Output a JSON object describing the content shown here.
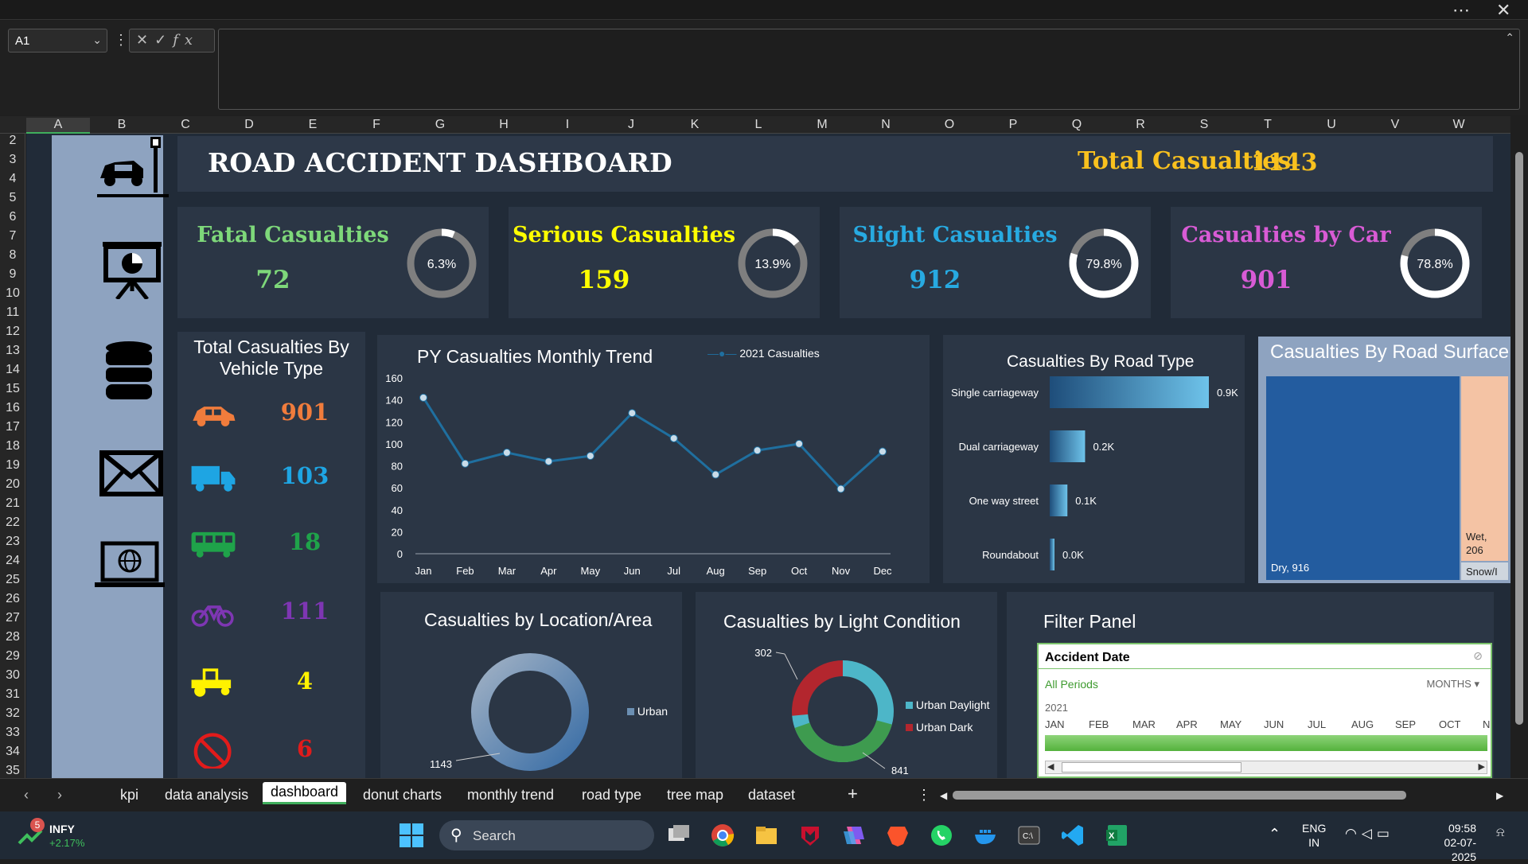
{
  "cell_ref": "A1",
  "columns": [
    "A",
    "B",
    "C",
    "D",
    "E",
    "F",
    "G",
    "H",
    "I",
    "J",
    "K",
    "L",
    "M",
    "N",
    "O",
    "P",
    "Q",
    "R",
    "S",
    "T",
    "U",
    "V",
    "W"
  ],
  "rows": [
    "2",
    "3",
    "4",
    "5",
    "6",
    "7",
    "8",
    "9",
    "10",
    "11",
    "12",
    "13",
    "14",
    "15",
    "16",
    "17",
    "18",
    "19",
    "20",
    "21",
    "22",
    "23",
    "24",
    "25",
    "26",
    "27",
    "28",
    "29",
    "30",
    "31",
    "32",
    "33",
    "34",
    "35"
  ],
  "dashboard": {
    "title": "ROAD ACCIDENT DASHBOARD",
    "total_label": "Total Casualties",
    "total_value": "1143"
  },
  "kpis": [
    {
      "label_a": "Fatal",
      "label_b": " Casualties",
      "value": "72",
      "pct": "6.3%",
      "fraction": 0.063,
      "colors": [
        "#7ed87a",
        "#7ed87a"
      ]
    },
    {
      "label_a": "Serious",
      "label_b": " Casualties",
      "value": "159",
      "pct": "13.9%",
      "fraction": 0.139,
      "colors": [
        "#ffff00",
        "#ffff00"
      ]
    },
    {
      "label_a": "Slight",
      "label_b": " Casualties",
      "value": "912",
      "pct": "79.8%",
      "fraction": 0.798,
      "colors": [
        "#27aae1",
        "#27aae1"
      ]
    },
    {
      "label_a": "Casualties",
      "label_b": " by Car",
      "value": "901",
      "pct": "78.8%",
      "fraction": 0.788,
      "colors": [
        "#d85bd5",
        "#d85bd5"
      ]
    }
  ],
  "vehicle": {
    "title": "Total Casualties By Vehicle Type",
    "items": [
      {
        "icon": "car-icon",
        "value": "901",
        "color": "#f07c3c"
      },
      {
        "icon": "truck-icon",
        "value": "103",
        "color": "#1ea5e3"
      },
      {
        "icon": "bus-icon",
        "value": "18",
        "color": "#1fa34a"
      },
      {
        "icon": "bicycle-icon",
        "value": "111",
        "color": "#7e36b3"
      },
      {
        "icon": "tractor-icon",
        "value": "4",
        "color": "#fff200"
      },
      {
        "icon": "no-entry-icon",
        "value": "6",
        "color": "#e11b1b"
      }
    ]
  },
  "chart_data": [
    {
      "type": "line",
      "title": "PY Casualties Monthly Trend",
      "series": [
        {
          "name": "2021 Casualties",
          "values": [
            142,
            82,
            92,
            84,
            89,
            128,
            105,
            72,
            94,
            100,
            59,
            93
          ]
        }
      ],
      "categories": [
        "Jan",
        "Feb",
        "Mar",
        "Apr",
        "May",
        "Jun",
        "Jul",
        "Aug",
        "Sep",
        "Oct",
        "Nov",
        "Dec"
      ],
      "yticks": [
        "160",
        "140",
        "120",
        "100",
        "80",
        "60",
        "40",
        "20",
        "0"
      ],
      "ylim": [
        0,
        160
      ]
    },
    {
      "type": "bar",
      "title": "Casualties By Road Type",
      "categories": [
        "Single carriageway",
        "Dual carriageway",
        "One way street",
        "Roundabout"
      ],
      "values": [
        0.9,
        0.2,
        0.1,
        0.0
      ],
      "labels": [
        "0.9K",
        "0.2K",
        "0.1K",
        "0.0K"
      ]
    },
    {
      "type": "heatmap",
      "title": "Casualties By Road Surface",
      "labels": [
        "Dry, 916",
        "Wet,",
        "206",
        "Snow/I"
      ],
      "values": [
        916,
        206
      ]
    },
    {
      "type": "pie",
      "title": "Casualties by Location/Area",
      "series": [
        {
          "name": "Urban",
          "values": [
            1143
          ]
        }
      ],
      "label": "1143"
    },
    {
      "type": "pie",
      "title": "Casualties by Light Condition",
      "series": [
        {
          "name": "Urban Daylight",
          "values": [
            841
          ]
        },
        {
          "name": "Urban Dark",
          "values": [
            302
          ]
        }
      ],
      "labels": [
        "302",
        "841"
      ]
    }
  ],
  "filter": {
    "title": "Filter Panel",
    "header": "Accident Date",
    "all_periods": "All Periods",
    "unit": "MONTHS",
    "year": "2021",
    "months": [
      "JAN",
      "FEB",
      "MAR",
      "APR",
      "MAY",
      "JUN",
      "JUL",
      "AUG",
      "SEP",
      "OCT",
      "N"
    ]
  },
  "tabs": [
    "kpi",
    "data analysis",
    "dashboard",
    "donut charts",
    "monthly trend",
    "road type",
    "tree map",
    "dataset"
  ],
  "active_tab": "dashboard",
  "taskbar": {
    "stock_name": "INFY",
    "stock_change": "+2.17%",
    "badge": "5",
    "search": "Search",
    "lang1": "ENG",
    "lang2": "IN",
    "time": "09:58",
    "date": "02-07-2025"
  }
}
